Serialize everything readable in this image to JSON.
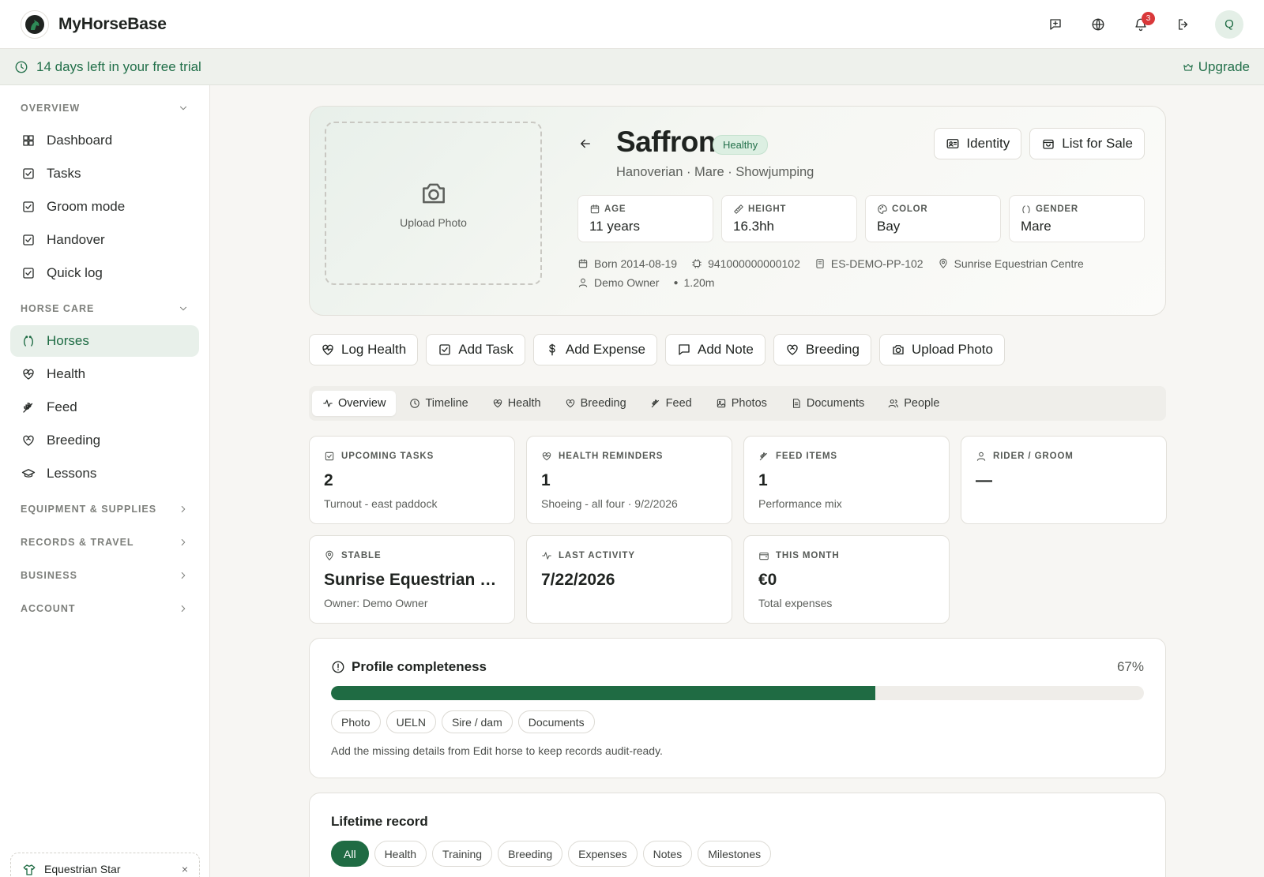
{
  "app": {
    "title": "MyHorseBase",
    "notifications": "3",
    "avatar_initial": "Q"
  },
  "trial": {
    "text": "14 days left in your free trial",
    "upgrade": "Upgrade"
  },
  "sidebar": {
    "sections": [
      {
        "title": "OVERVIEW",
        "items": [
          "Dashboard",
          "Tasks",
          "Groom mode",
          "Handover",
          "Quick log"
        ]
      },
      {
        "title": "HORSE CARE",
        "items": [
          "Horses",
          "Health",
          "Feed",
          "Breeding",
          "Lessons"
        ]
      },
      {
        "title": "EQUIPMENT & SUPPLIES"
      },
      {
        "title": "RECORDS & TRAVEL"
      },
      {
        "title": "BUSINESS"
      },
      {
        "title": "ACCOUNT"
      }
    ],
    "active_item": "Horses",
    "card_label": "Equestrian Star",
    "card_close": "×"
  },
  "horse": {
    "name": "Saffron",
    "status": "Healthy",
    "subtitle": "Hanoverian · Mare · Showjumping",
    "upload_label": "Upload Photo",
    "actions": {
      "identity": "Identity",
      "sale": "List for Sale"
    },
    "stats": [
      {
        "label": "AGE",
        "value": "11 years",
        "icon": "calendar-icon"
      },
      {
        "label": "HEIGHT",
        "value": "16.3hh",
        "icon": "ruler-icon"
      },
      {
        "label": "COLOR",
        "value": "Bay",
        "icon": "palette-icon"
      },
      {
        "label": "GENDER",
        "value": "Mare",
        "icon": "gender-icon"
      }
    ],
    "meta": {
      "born": "Born 2014-08-19",
      "chip": "941000000000102",
      "passport": "ES-DEMO-PP-102",
      "location": "Sunrise Equestrian Centre",
      "owner": "Demo Owner",
      "jump_height": "1.20m"
    }
  },
  "quick_actions": [
    "Log Health",
    "Add Task",
    "Add Expense",
    "Add Note",
    "Breeding",
    "Upload Photo"
  ],
  "tabs": [
    "Overview",
    "Timeline",
    "Health",
    "Breeding",
    "Feed",
    "Photos",
    "Documents",
    "People"
  ],
  "active_tab": "Overview",
  "cards": [
    {
      "label": "UPCOMING TASKS",
      "value": "2",
      "sub": "Turnout - east paddock"
    },
    {
      "label": "HEALTH REMINDERS",
      "value": "1",
      "sub": "Shoeing - all four · 9/2/2026"
    },
    {
      "label": "FEED ITEMS",
      "value": "1",
      "sub": "Performance mix"
    },
    {
      "label": "RIDER / GROOM",
      "value": "—",
      "sub": ""
    },
    {
      "label": "STABLE",
      "value": "Sunrise Equestrian C...",
      "sub": "Owner: Demo Owner"
    },
    {
      "label": "LAST ACTIVITY",
      "value": "7/22/2026",
      "sub": ""
    },
    {
      "label": "THIS MONTH",
      "value": "€0",
      "sub": "Total expenses"
    }
  ],
  "completeness": {
    "title": "Profile completeness",
    "percent_label": "67%",
    "percent": 67,
    "missing": [
      "Photo",
      "UELN",
      "Sire / dam",
      "Documents"
    ],
    "hint": "Add the missing details from Edit horse to keep records audit-ready."
  },
  "lifetime": {
    "title": "Lifetime record",
    "filters": [
      "All",
      "Health",
      "Training",
      "Breeding",
      "Expenses",
      "Notes",
      "Milestones"
    ],
    "active_filter": "All"
  },
  "colors": {
    "brand_green": "#1f6b43",
    "badge_red": "#d9383a"
  }
}
